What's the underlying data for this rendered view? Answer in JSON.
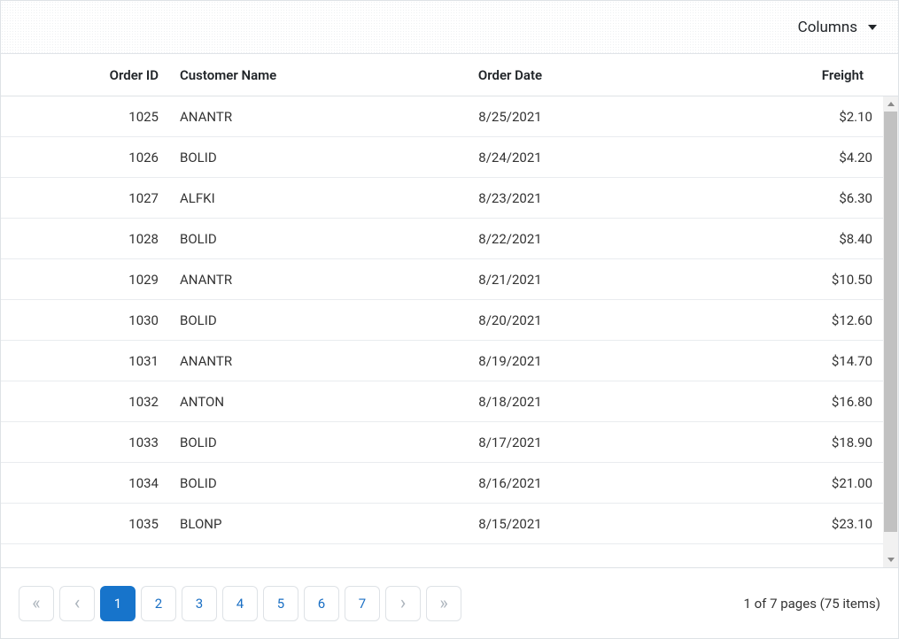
{
  "toolbar": {
    "columns_label": "Columns"
  },
  "columns": {
    "order_id": "Order ID",
    "customer_name": "Customer Name",
    "order_date": "Order Date",
    "freight": "Freight"
  },
  "rows": [
    {
      "order_id": "1025",
      "customer": "ANANTR",
      "date": "8/25/2021",
      "freight": "$2.10"
    },
    {
      "order_id": "1026",
      "customer": "BOLID",
      "date": "8/24/2021",
      "freight": "$4.20"
    },
    {
      "order_id": "1027",
      "customer": "ALFKI",
      "date": "8/23/2021",
      "freight": "$6.30"
    },
    {
      "order_id": "1028",
      "customer": "BOLID",
      "date": "8/22/2021",
      "freight": "$8.40"
    },
    {
      "order_id": "1029",
      "customer": "ANANTR",
      "date": "8/21/2021",
      "freight": "$10.50"
    },
    {
      "order_id": "1030",
      "customer": "BOLID",
      "date": "8/20/2021",
      "freight": "$12.60"
    },
    {
      "order_id": "1031",
      "customer": "ANANTR",
      "date": "8/19/2021",
      "freight": "$14.70"
    },
    {
      "order_id": "1032",
      "customer": "ANTON",
      "date": "8/18/2021",
      "freight": "$16.80"
    },
    {
      "order_id": "1033",
      "customer": "BOLID",
      "date": "8/17/2021",
      "freight": "$18.90"
    },
    {
      "order_id": "1034",
      "customer": "BOLID",
      "date": "8/16/2021",
      "freight": "$21.00"
    },
    {
      "order_id": "1035",
      "customer": "BLONP",
      "date": "8/15/2021",
      "freight": "$23.10"
    }
  ],
  "pager": {
    "pages": [
      "1",
      "2",
      "3",
      "4",
      "5",
      "6",
      "7"
    ],
    "active_index": 0,
    "info": "1 of 7 pages (75 items)"
  }
}
